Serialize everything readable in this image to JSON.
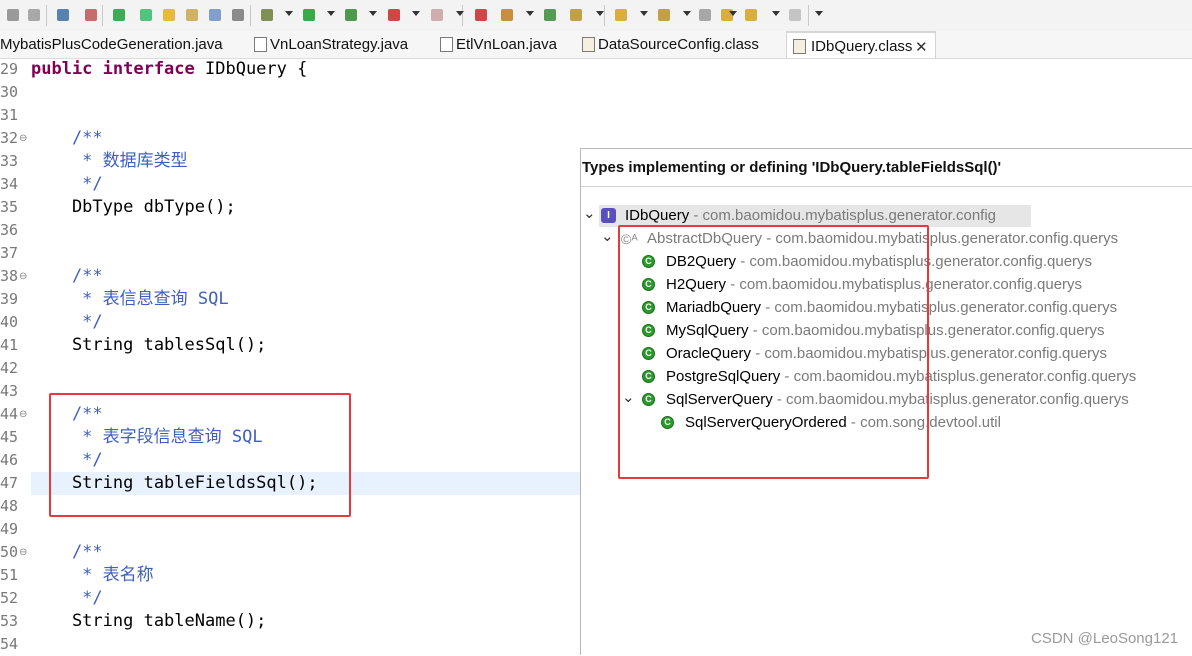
{
  "editor_tabs": [
    {
      "label": "MybatisPlusCodeGeneration.java",
      "active": false,
      "icon": "java-file-icon"
    },
    {
      "label": "VnLoanStrategy.java",
      "active": false,
      "icon": "java-file-icon"
    },
    {
      "label": "EtlVnLoan.java",
      "active": false,
      "icon": "java-file-icon"
    },
    {
      "label": "DataSourceConfig.class",
      "active": false,
      "icon": "class-file-icon"
    },
    {
      "label": "IDbQuery.class",
      "active": true,
      "icon": "class-file-icon"
    }
  ],
  "tab_close_glyph": "✕",
  "code_lines": [
    {
      "n": "29",
      "parts": [
        {
          "t": "public interface ",
          "s": "kw"
        },
        {
          "t": "IDbQuery {",
          "s": "pl"
        }
      ]
    },
    {
      "n": "30",
      "parts": []
    },
    {
      "n": "31",
      "parts": []
    },
    {
      "n": "32",
      "fold": true,
      "parts": [
        {
          "t": "    /**",
          "s": "cm"
        }
      ]
    },
    {
      "n": "33",
      "parts": [
        {
          "t": "     * 数据库类型",
          "s": "cm"
        }
      ]
    },
    {
      "n": "34",
      "parts": [
        {
          "t": "     */",
          "s": "cm"
        }
      ]
    },
    {
      "n": "35",
      "parts": [
        {
          "t": "    DbType dbType();",
          "s": "pl"
        }
      ]
    },
    {
      "n": "36",
      "parts": []
    },
    {
      "n": "37",
      "parts": []
    },
    {
      "n": "38",
      "fold": true,
      "parts": [
        {
          "t": "    /**",
          "s": "cm"
        }
      ]
    },
    {
      "n": "39",
      "parts": [
        {
          "t": "     * 表信息查询 SQL",
          "s": "cm"
        }
      ]
    },
    {
      "n": "40",
      "parts": [
        {
          "t": "     */",
          "s": "cm"
        }
      ]
    },
    {
      "n": "41",
      "parts": [
        {
          "t": "    String tablesSql();",
          "s": "pl"
        }
      ]
    },
    {
      "n": "42",
      "parts": []
    },
    {
      "n": "43",
      "parts": []
    },
    {
      "n": "44",
      "fold": true,
      "parts": [
        {
          "t": "    /**",
          "s": "cm"
        }
      ]
    },
    {
      "n": "45",
      "parts": [
        {
          "t": "     * 表字段信息查询 SQL",
          "s": "cm"
        }
      ]
    },
    {
      "n": "46",
      "parts": [
        {
          "t": "     */",
          "s": "cm"
        }
      ]
    },
    {
      "n": "47",
      "current": true,
      "parts": [
        {
          "t": "    String tableFieldsSql();",
          "s": "pl"
        }
      ]
    },
    {
      "n": "48",
      "parts": []
    },
    {
      "n": "49",
      "parts": []
    },
    {
      "n": "50",
      "fold": true,
      "parts": [
        {
          "t": "    /**",
          "s": "cm"
        }
      ]
    },
    {
      "n": "51",
      "parts": [
        {
          "t": "     * 表名称",
          "s": "cm"
        }
      ]
    },
    {
      "n": "52",
      "parts": [
        {
          "t": "     */",
          "s": "cm"
        }
      ]
    },
    {
      "n": "53",
      "parts": [
        {
          "t": "    String tableName();",
          "s": "pl"
        }
      ]
    },
    {
      "n": "54",
      "parts": []
    }
  ],
  "hierarchy": {
    "title": "Types implementing or defining 'IDbQuery.tableFieldsSql()'",
    "nodes": [
      {
        "name": "IDbQuery",
        "pkg": " - com.baomidou.mybatisplus.generator.config",
        "kind": "interface",
        "depth": 0,
        "expanded": true,
        "selected": true,
        "icon": "interface-icon"
      },
      {
        "name": "AbstractDbQuery",
        "pkg": " - com.baomidou.mybatisplus.generator.config.querys",
        "kind": "abstract",
        "depth": 1,
        "expanded": true,
        "icon": "abstract-class-icon"
      },
      {
        "name": "DB2Query",
        "pkg": " - com.baomidou.mybatisplus.generator.config.querys",
        "kind": "class",
        "depth": 2,
        "icon": "class-icon"
      },
      {
        "name": "H2Query",
        "pkg": " - com.baomidou.mybatisplus.generator.config.querys",
        "kind": "class",
        "depth": 2,
        "icon": "class-icon"
      },
      {
        "name": "MariadbQuery",
        "pkg": " - com.baomidou.mybatisplus.generator.config.querys",
        "kind": "class",
        "depth": 2,
        "icon": "class-icon"
      },
      {
        "name": "MySqlQuery",
        "pkg": " - com.baomidou.mybatisplus.generator.config.querys",
        "kind": "class",
        "depth": 2,
        "icon": "class-icon"
      },
      {
        "name": "OracleQuery",
        "pkg": " - com.baomidou.mybatisplus.generator.config.querys",
        "kind": "class",
        "depth": 2,
        "icon": "class-icon"
      },
      {
        "name": "PostgreSqlQuery",
        "pkg": " - com.baomidou.mybatisplus.generator.config.querys",
        "kind": "class",
        "depth": 2,
        "icon": "class-icon"
      },
      {
        "name": "SqlServerQuery",
        "pkg": " - com.baomidou.mybatisplus.generator.config.querys",
        "kind": "class",
        "depth": 2,
        "expanded": true,
        "icon": "class-icon"
      },
      {
        "name": "SqlServerQueryOrdered",
        "pkg": " - com.song.devtool.util",
        "kind": "class",
        "depth": 3,
        "icon": "class-icon"
      }
    ]
  },
  "watermark": "CSDN @LeoSong121",
  "colors": {
    "keyword": "#7f0055",
    "comment": "#3f5fbf",
    "highlight_box": "#e23b3b",
    "current_line": "#e8f2fe"
  },
  "toolbar_icons": [
    "save-icon",
    "save-all-icon",
    "console-icon",
    "skip-breakpoints-icon",
    "stop-icon",
    "toggle-mark-icon",
    "toggle-highlight-icon",
    "block-selection-icon",
    "word-wrap-icon",
    "show-whitespace-icon",
    "debug-icon",
    "run-icon",
    "coverage-icon",
    "external-tools-icon",
    "build-icon",
    "new-java-package-icon",
    "new-java-class-icon",
    "open-type-icon",
    "open-task-icon",
    "next-annotation-icon",
    "previous-annotation-icon",
    "last-edit-location-icon",
    "back-icon",
    "forward-icon",
    "pin-editor-icon"
  ]
}
